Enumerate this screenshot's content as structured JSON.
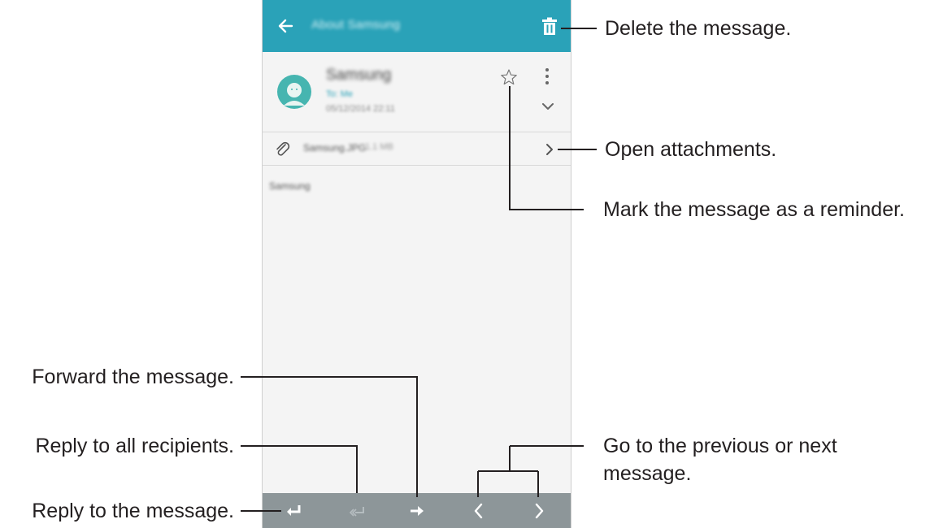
{
  "app_bar": {
    "subject": "About Samsung",
    "icons": {
      "back": "back-arrow-icon",
      "delete": "trash-icon"
    }
  },
  "message": {
    "sender": "Samsung",
    "recipient": "To: Me",
    "datetime": "05/12/2014 22:11",
    "icons": {
      "avatar": "contact-avatar-icon",
      "star": "star-outline-icon",
      "more": "more-vert-icon",
      "expand": "chevron-down-icon"
    }
  },
  "attachment": {
    "filename": "Samsung.JPG",
    "size": "1.1 MB",
    "icons": {
      "clip": "paperclip-icon",
      "open": "chevron-right-icon"
    }
  },
  "body_text": "Samsung",
  "bottom_bar": {
    "icons": [
      "reply-icon",
      "reply-all-icon",
      "forward-icon",
      "previous-icon",
      "next-icon"
    ]
  },
  "colors": {
    "accent": "#2aa2b8",
    "bottom_bar": "#8d9699",
    "background": "#f4f4f4"
  },
  "callouts": {
    "delete": "Delete the message.",
    "open_attachments": "Open attachments.",
    "reminder": "Mark the message as a reminder.",
    "forward": "Forward the message.",
    "reply_all": "Reply to all recipients.",
    "reply": "Reply to the message.",
    "prev_next_line1": "Go to the previous or next",
    "prev_next_line2": "message."
  }
}
